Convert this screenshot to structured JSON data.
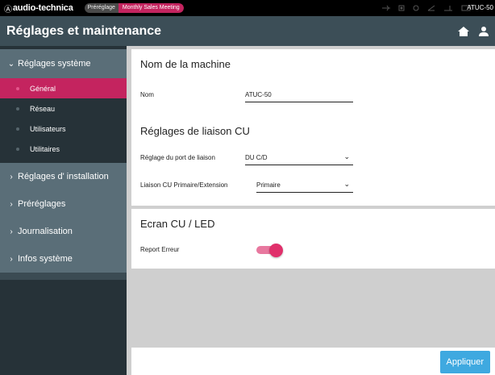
{
  "topbar": {
    "brand": "audio-technica",
    "brand_mark": "Ⓐ",
    "preset_label": "Préréglage",
    "preset_value": "Monthly Sales Meeting",
    "device_name": "ATUC-50"
  },
  "header": {
    "title": "Réglages et maintenance",
    "icons": [
      "home-icon",
      "user-icon"
    ]
  },
  "sidebar": {
    "sections": [
      {
        "label": "Réglages système",
        "expanded": true,
        "chevron": "⌄",
        "items": [
          {
            "label": "Général",
            "active": true
          },
          {
            "label": "Réseau",
            "active": false
          },
          {
            "label": "Utilisateurs",
            "active": false
          },
          {
            "label": "Utilitaires",
            "active": false
          }
        ]
      },
      {
        "label": "Réglages d' installation",
        "expanded": false,
        "chevron": "›"
      },
      {
        "label": "Préréglages",
        "expanded": false,
        "chevron": "›"
      },
      {
        "label": "Journalisation",
        "expanded": false,
        "chevron": "›"
      },
      {
        "label": "Infos système",
        "expanded": false,
        "chevron": "›"
      }
    ]
  },
  "main": {
    "machine_name": {
      "title": "Nom de la machine",
      "field_label": "Nom",
      "value": "ATUC-50"
    },
    "link": {
      "title": "Réglages de liaison CU",
      "port_label": "Réglage du port de liaison",
      "port_value": "DU C/D",
      "mode_label": "Liaison CU Primaire/Extension",
      "mode_value": "Primaire"
    },
    "screen": {
      "title": "Ecran CU / LED",
      "error_label": "Report Erreur",
      "error_enabled": true
    },
    "apply_label": "Appliquer"
  },
  "colors": {
    "accent": "#c4245f",
    "header": "#3c4e57",
    "sidebar_dark": "#263238",
    "sidebar_section": "#5a6e78",
    "apply_button": "#3fa9e0",
    "toggle_on": "#e0306b"
  }
}
